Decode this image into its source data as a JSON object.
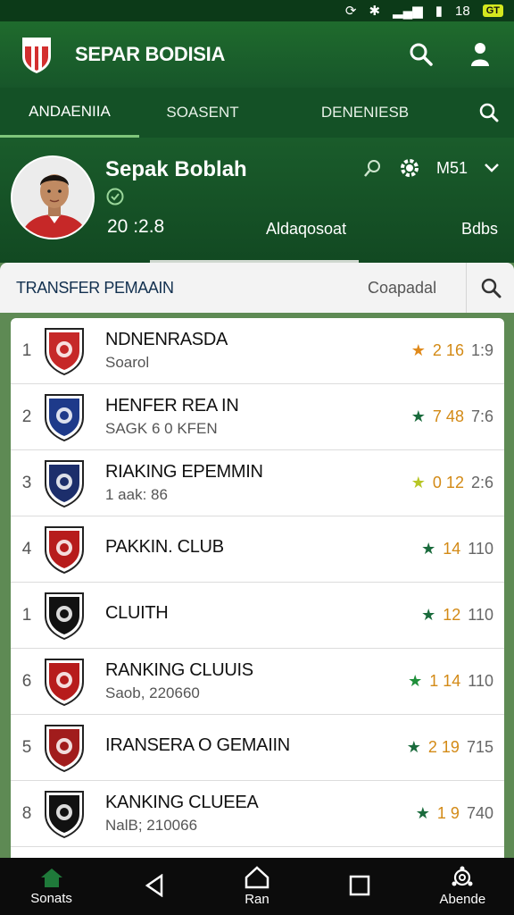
{
  "status": {
    "time": "18",
    "battery": "GT"
  },
  "app": {
    "title": "SEPAR BODISIA"
  },
  "tabs": [
    {
      "label": "ANDAENIIA"
    },
    {
      "label": "SOASENT"
    },
    {
      "label": "DENENIESB"
    }
  ],
  "profile": {
    "name": "Sepak Boblah",
    "score": "20 :2.8",
    "action_label": "M51",
    "stat_1": "Aldaqosoat",
    "stat_2": "Bdbs"
  },
  "searchbar": {
    "title": "TRANSFER PEMAAIN",
    "placeholder": "Coapadal"
  },
  "rows": [
    {
      "rank": "1",
      "name": "NDNENRASDA",
      "sub": "Soarol",
      "s1": "2 16",
      "s2": "1:9",
      "star_color": "#e08a1b",
      "crest_bg": "#c62828"
    },
    {
      "rank": "2",
      "name": "HENFER REA   IN",
      "sub": "SAGK 6 0 KFEN",
      "s1": "7 48",
      "s2": "7:6",
      "star_color": "#1a6b3c",
      "crest_bg": "#1e3a8a"
    },
    {
      "rank": "3",
      "name": "RIAKING EPEMMIN",
      "sub": "1 aak: 86",
      "s1": "0 12",
      "s2": "2:6",
      "star_color": "#b7c626",
      "crest_bg": "#1c2e6b"
    },
    {
      "rank": "4",
      "name": "PAKKIN. CLUB",
      "sub": "",
      "s1": "14",
      "s2": "110",
      "star_color": "#1a6b3c",
      "crest_bg": "#b71c1c"
    },
    {
      "rank": "1",
      "name": "CLUITH",
      "sub": "",
      "s1": "12",
      "s2": "110",
      "star_color": "#1a6b3c",
      "crest_bg": "#111111"
    },
    {
      "rank": "6",
      "name": "RANKING CLUUIS",
      "sub": "Saob, 220660",
      "s1": "1 14",
      "s2": "110",
      "star_color": "#1f8f3a",
      "crest_bg": "#b71c1c"
    },
    {
      "rank": "5",
      "name": "IRANSERA O GEMAIIN",
      "sub": "",
      "s1": "2 19",
      "s2": "715",
      "star_color": "#1a6b3c",
      "crest_bg": "#a11c1c"
    },
    {
      "rank": "8",
      "name": "KANKING CLUEEA",
      "sub": "NalB; 210066",
      "s1": "1   9",
      "s2": "740",
      "star_color": "#1a6b3c",
      "crest_bg": "#111111"
    }
  ],
  "nav": [
    {
      "label": "Sonats",
      "icon": "home-icon"
    },
    {
      "label": "",
      "icon": "back-icon"
    },
    {
      "label": "Ran",
      "icon": "home-outline-icon"
    },
    {
      "label": "",
      "icon": "recent-apps-icon"
    },
    {
      "label": "Abende",
      "icon": "settings-icon"
    }
  ],
  "colors": {
    "primary": "#1b5e2a",
    "accent": "#7fc67b",
    "orange": "#d38a16"
  }
}
